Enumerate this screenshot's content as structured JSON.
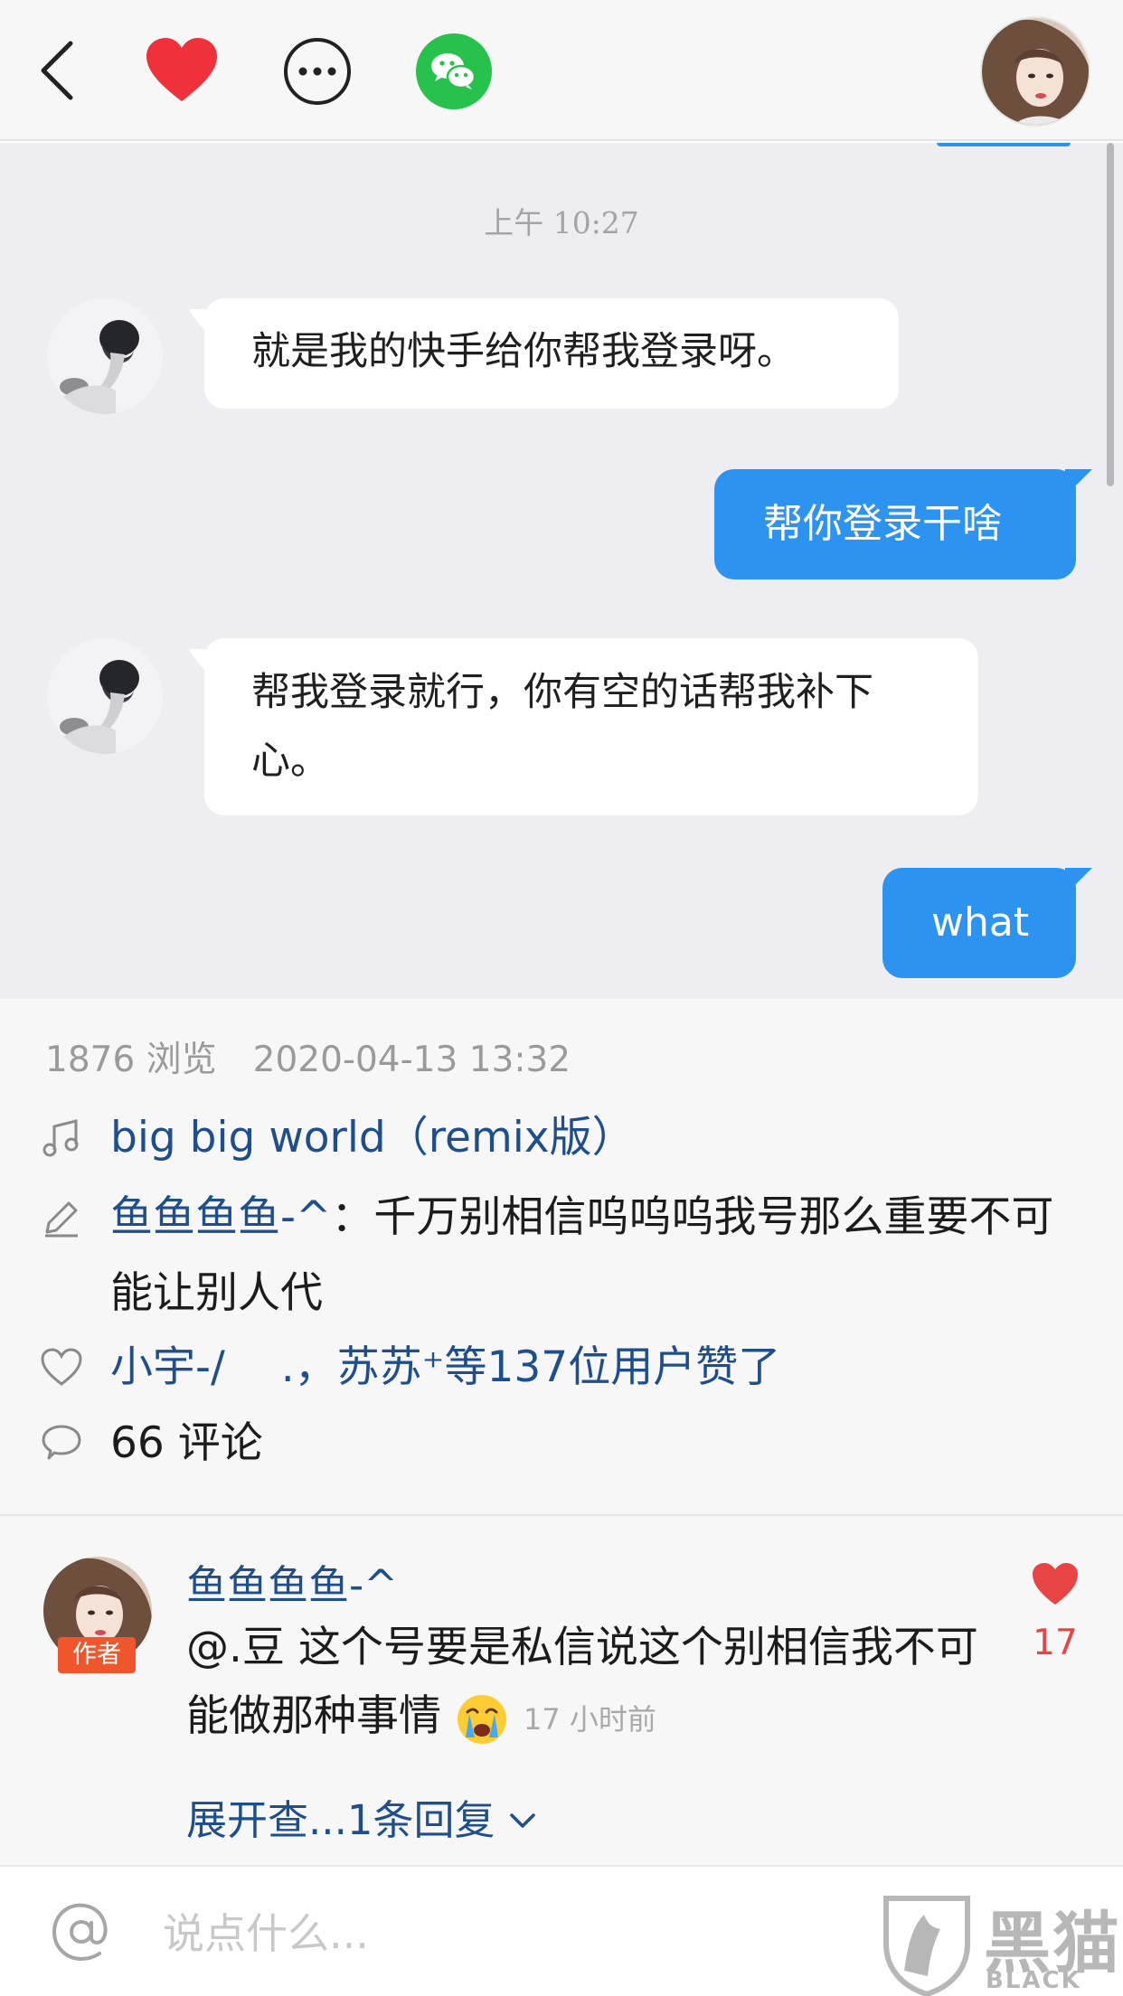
{
  "chat": {
    "time": "上午 10:27",
    "messages": [
      {
        "from": "other",
        "text": "就是我的快手给你帮我登录呀。"
      },
      {
        "from": "me",
        "text": "帮你登录干啥"
      },
      {
        "from": "other",
        "text": "帮我登录就行，你有空的话帮我补下心。"
      },
      {
        "from": "me",
        "text": "what"
      }
    ]
  },
  "post": {
    "views": "1876 浏览",
    "date": "2020-04-13 13:32",
    "music": "big big world（remix版）",
    "author": "鱼鱼鱼鱼-^",
    "caption": "：千万别相信呜呜呜我号那么重要不可能让别人代",
    "likers": "小宇-/　 .，苏苏⁺",
    "likes_suffix": "等137位用户赞了",
    "comments": "66 评论"
  },
  "comment": {
    "name": "鱼鱼鱼鱼-^",
    "badge": "作者",
    "text": "@.豆 这个号要是私信说这个别相信我不可能做那种事情",
    "time": "17 小时前",
    "likes": "17",
    "expand": "展开查...1条回复"
  },
  "input": {
    "placeholder": "说点什么..."
  },
  "watermark": {
    "title": "黑猫",
    "subtitle": "BLACK CAT"
  },
  "colors": {
    "accent_blue": "#2d93f0",
    "link": "#1f4e8c",
    "like_red": "#e84444",
    "wechat_green": "#27c24c",
    "author_badge": "#f0552b"
  }
}
